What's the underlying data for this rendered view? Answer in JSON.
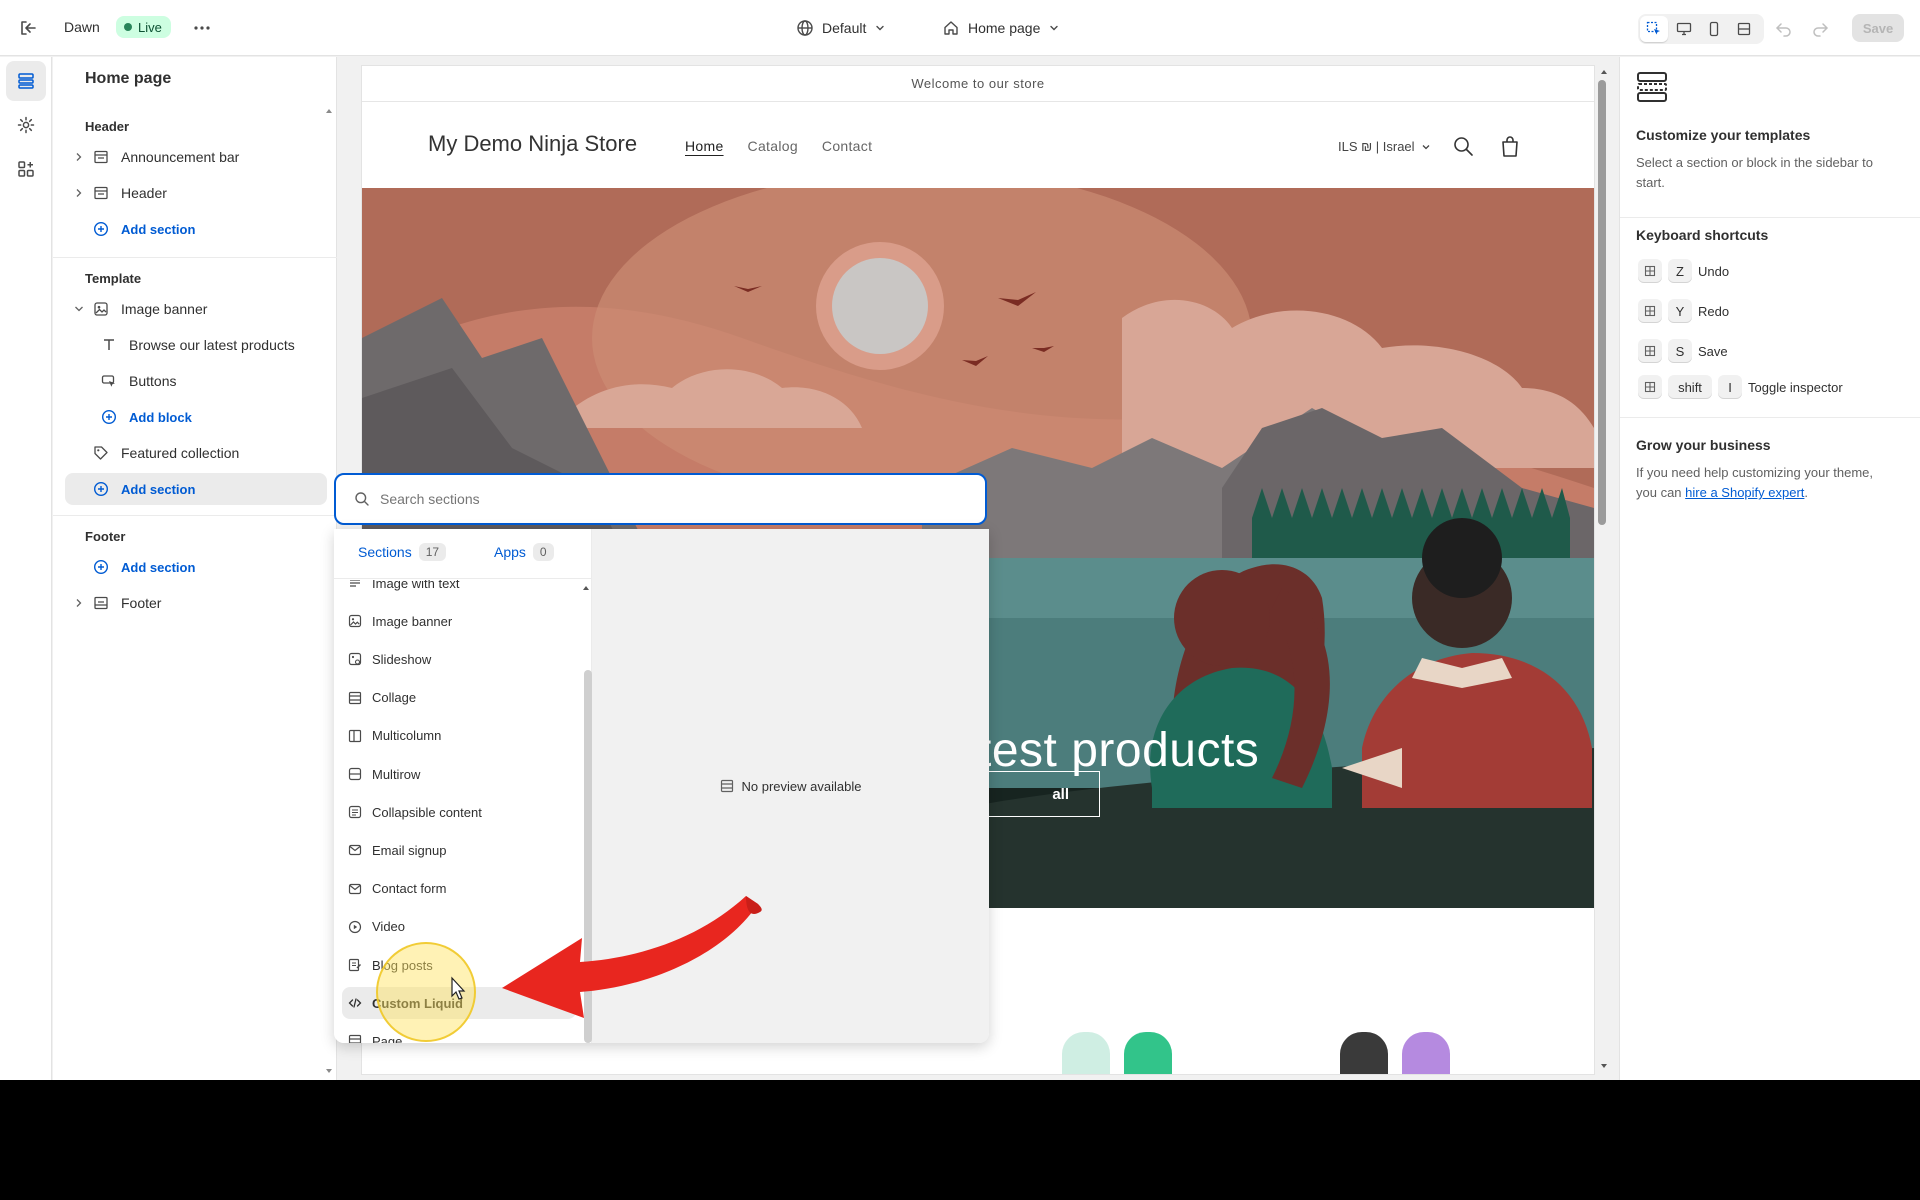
{
  "topbar": {
    "theme_name": "Dawn",
    "status_badge": "Live",
    "theme_selector": "Default",
    "page_selector": "Home page",
    "save_label": "Save"
  },
  "sidebar": {
    "title": "Home page",
    "header_group": {
      "label": "Header",
      "items": [
        "Announcement bar",
        "Header"
      ],
      "add_label": "Add section"
    },
    "template_group": {
      "label": "Template",
      "image_banner": "Image banner",
      "blocks": [
        "Browse our latest products",
        "Buttons"
      ],
      "add_block_label": "Add block",
      "featured_collection": "Featured collection",
      "add_label": "Add section"
    },
    "footer_group": {
      "label": "Footer",
      "add_label": "Add section",
      "item": "Footer"
    }
  },
  "preview": {
    "announcement": "Welcome to our store",
    "store_name": "My Demo Ninja Store",
    "nav": [
      "Home",
      "Catalog",
      "Contact"
    ],
    "currency": "ILS ₪ | Israel",
    "banner_heading": "test products",
    "banner_button": "all"
  },
  "section_picker": {
    "search_placeholder": "Search sections",
    "tabs": [
      {
        "label": "Sections",
        "count": "17"
      },
      {
        "label": "Apps",
        "count": "0"
      }
    ],
    "items": [
      {
        "label": "Image with text",
        "icon": "image-text-icon"
      },
      {
        "label": "Image banner",
        "icon": "image-icon"
      },
      {
        "label": "Slideshow",
        "icon": "slideshow-icon"
      },
      {
        "label": "Collage",
        "icon": "collage-icon"
      },
      {
        "label": "Multicolumn",
        "icon": "columns-icon"
      },
      {
        "label": "Multirow",
        "icon": "rows-icon"
      },
      {
        "label": "Collapsible content",
        "icon": "collapsible-icon"
      },
      {
        "label": "Email signup",
        "icon": "email-icon"
      },
      {
        "label": "Contact form",
        "icon": "email-icon"
      },
      {
        "label": "Video",
        "icon": "play-icon"
      },
      {
        "label": "Blog posts",
        "icon": "blog-icon"
      },
      {
        "label": "Custom Liquid",
        "icon": "code-icon"
      },
      {
        "label": "Page",
        "icon": "page-icon"
      }
    ],
    "preview_text": "No preview available"
  },
  "right_panel": {
    "title": "Customize your templates",
    "description": "Select a section or block in the sidebar to start.",
    "shortcuts_title": "Keyboard shortcuts",
    "shortcuts": [
      {
        "keys": [
          "Z"
        ],
        "label": "Undo"
      },
      {
        "keys": [
          "Y"
        ],
        "label": "Redo"
      },
      {
        "keys": [
          "S"
        ],
        "label": "Save"
      },
      {
        "keys": [
          "shift",
          "I"
        ],
        "label": "Toggle inspector"
      }
    ],
    "grow_title": "Grow your business",
    "grow_text_before": "If you need help customizing your theme, you can",
    "grow_link": "hire a Shopify expert",
    "grow_text_after": "."
  },
  "colors": {
    "accent": "#005bd3",
    "live_badge_bg": "#cdfee1",
    "live_badge_dot": "#29845a",
    "annotation_arrow": "#e8261f",
    "cursor_highlight": "#ffe25a"
  }
}
